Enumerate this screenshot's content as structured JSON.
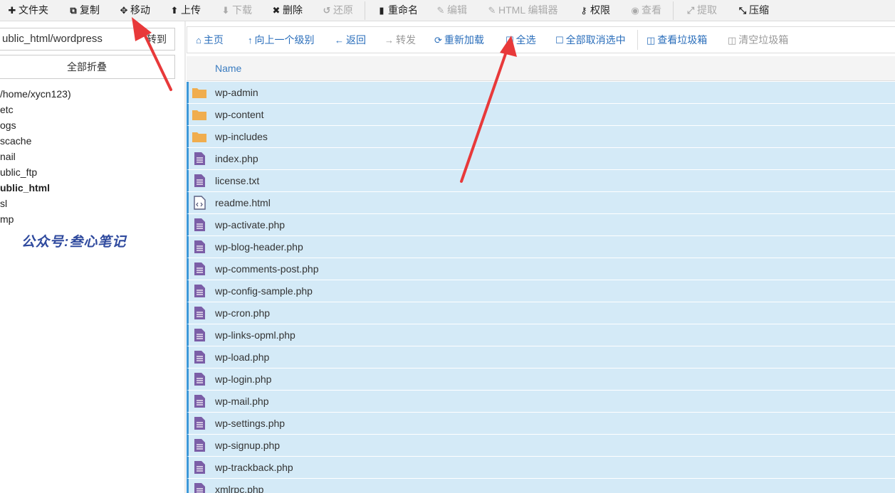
{
  "toolbar": {
    "items": [
      {
        "label": "文件夹",
        "icon": "plus-icon",
        "glyph": "✚",
        "enabled": true
      },
      {
        "label": "复制",
        "icon": "copy-icon",
        "glyph": "⧉",
        "enabled": true
      },
      {
        "label": "移动",
        "icon": "move-icon",
        "glyph": "✥",
        "enabled": true
      },
      {
        "label": "上传",
        "icon": "upload-icon",
        "glyph": "⬆",
        "enabled": true
      },
      {
        "label": "下载",
        "icon": "download-icon",
        "glyph": "⬇",
        "enabled": false
      },
      {
        "label": "删除",
        "icon": "close-icon",
        "glyph": "✖",
        "enabled": true
      },
      {
        "label": "还原",
        "icon": "undo-icon",
        "glyph": "↺",
        "enabled": false
      },
      {
        "label": "重命名",
        "icon": "file-icon",
        "glyph": "▮",
        "enabled": true
      },
      {
        "label": "编辑",
        "icon": "pencil-icon",
        "glyph": "✎",
        "enabled": false
      },
      {
        "label": "HTML 编辑器",
        "icon": "edit-icon",
        "glyph": "✎",
        "enabled": false
      },
      {
        "label": "权限",
        "icon": "key-icon",
        "glyph": "⚷",
        "enabled": true
      },
      {
        "label": "查看",
        "icon": "eye-icon",
        "glyph": "◉",
        "enabled": false
      },
      {
        "label": "提取",
        "icon": "expand-icon",
        "glyph": "⤢",
        "enabled": false
      },
      {
        "label": "压缩",
        "icon": "compress-icon",
        "glyph": "⤡",
        "enabled": true
      }
    ]
  },
  "left": {
    "path_value": "ublic_html/wordpress",
    "go_label": "转到",
    "collapse_label": "全部折叠",
    "tree": [
      {
        "label": "/home/xycn123)",
        "bold": false
      },
      {
        "label": "etc",
        "bold": false
      },
      {
        "label": "ogs",
        "bold": false
      },
      {
        "label": "scache",
        "bold": false
      },
      {
        "label": "nail",
        "bold": false
      },
      {
        "label": "ublic_ftp",
        "bold": false
      },
      {
        "label": "ublic_html",
        "bold": true
      },
      {
        "label": "sl",
        "bold": false
      },
      {
        "label": "mp",
        "bold": false
      }
    ],
    "watermark": "公众号:叁心笔记"
  },
  "nav": {
    "items": [
      {
        "label": "主页",
        "icon": "home-icon",
        "glyph": "⌂",
        "enabled": true
      },
      {
        "label": "向上一个级别",
        "icon": "level-up-icon",
        "glyph": "↑",
        "enabled": true
      },
      {
        "label": "返回",
        "icon": "arrow-left-icon",
        "glyph": "←",
        "enabled": true
      },
      {
        "label": "转发",
        "icon": "arrow-right-icon",
        "glyph": "→",
        "enabled": false
      },
      {
        "label": "重新加载",
        "icon": "refresh-icon",
        "glyph": "⟳",
        "enabled": true
      },
      {
        "label": "全选",
        "icon": "checkbox-checked-icon",
        "glyph": "☑",
        "enabled": true
      },
      {
        "label": "全部取消选中",
        "icon": "checkbox-empty-icon",
        "glyph": "☐",
        "enabled": true
      },
      {
        "label": "查看垃圾箱",
        "icon": "trash-icon",
        "glyph": "🗑",
        "enabled": true
      },
      {
        "label": "清空垃圾箱",
        "icon": "trash-empty-icon",
        "glyph": "🗑",
        "enabled": false
      }
    ]
  },
  "table": {
    "header_name": "Name",
    "rows": [
      {
        "name": "wp-admin",
        "type": "folder"
      },
      {
        "name": "wp-content",
        "type": "folder"
      },
      {
        "name": "wp-includes",
        "type": "folder"
      },
      {
        "name": "index.php",
        "type": "file"
      },
      {
        "name": "license.txt",
        "type": "file"
      },
      {
        "name": "readme.html",
        "type": "code"
      },
      {
        "name": "wp-activate.php",
        "type": "file"
      },
      {
        "name": "wp-blog-header.php",
        "type": "file"
      },
      {
        "name": "wp-comments-post.php",
        "type": "file"
      },
      {
        "name": "wp-config-sample.php",
        "type": "file"
      },
      {
        "name": "wp-cron.php",
        "type": "file"
      },
      {
        "name": "wp-links-opml.php",
        "type": "file"
      },
      {
        "name": "wp-load.php",
        "type": "file"
      },
      {
        "name": "wp-login.php",
        "type": "file"
      },
      {
        "name": "wp-mail.php",
        "type": "file"
      },
      {
        "name": "wp-settings.php",
        "type": "file"
      },
      {
        "name": "wp-signup.php",
        "type": "file"
      },
      {
        "name": "wp-trackback.php",
        "type": "file"
      },
      {
        "name": "xmlrpc.php",
        "type": "file"
      }
    ]
  },
  "colors": {
    "accent": "#2a6ebb",
    "selected_row": "#d4eaf7",
    "folder": "#f0ad4e",
    "file": "#7b5ea7",
    "arrow": "#e8393a"
  }
}
